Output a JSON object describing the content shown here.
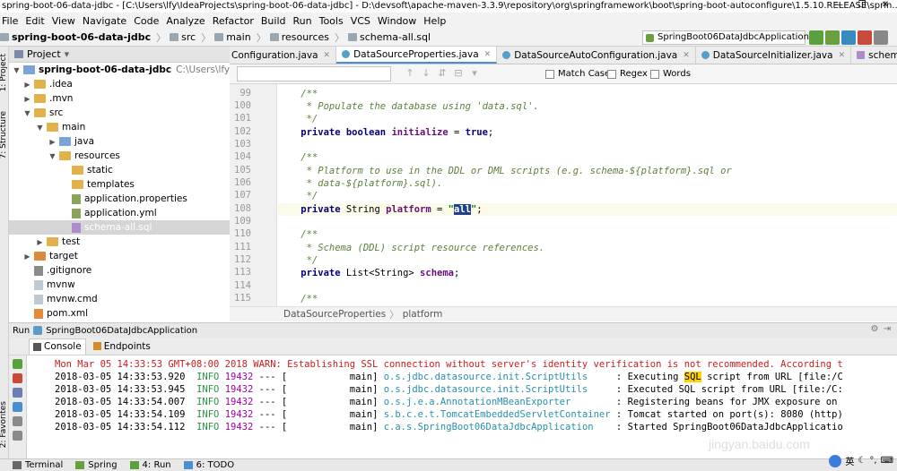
{
  "window": {
    "title": "spring-boot-06-data-jdbc - [C:\\Users\\lfy\\IdeaProjects\\spring-boot-06-data-jdbc] - D:\\devsoft\\apache-maven-3.3.9\\repository\\org\\springframework\\boot\\spring-boot-autoconfigure\\1.5.10.RELEASE\\sprin...",
    "controls": [
      "—",
      "❐",
      "✕"
    ]
  },
  "menu": [
    "File",
    "Edit",
    "View",
    "Navigate",
    "Code",
    "Analyze",
    "Refactor",
    "Build",
    "Run",
    "Tools",
    "VCS",
    "Window",
    "Help"
  ],
  "breadcrumb": [
    "spring-boot-06-data-jdbc",
    "src",
    "main",
    "resources",
    "schema-all.sql"
  ],
  "run_config": "SpringBoot06DataJdbcApplication",
  "sidebar_tabs": {
    "project": "1: Project",
    "structure": "7: Structure",
    "favorites": "2: Favorites"
  },
  "project_panel": {
    "title": "Project",
    "root": {
      "name": "spring-boot-06-data-jdbc",
      "path": "C:\\Users\\lfy\\IdeaProject"
    },
    "items": [
      {
        "label": ".idea"
      },
      {
        "label": ".mvn"
      },
      {
        "label": "src"
      },
      {
        "label": "main"
      },
      {
        "label": "java"
      },
      {
        "label": "resources"
      },
      {
        "label": "static"
      },
      {
        "label": "templates"
      },
      {
        "label": "application.properties"
      },
      {
        "label": "application.yml"
      },
      {
        "label": "schema-all.sql"
      },
      {
        "label": "test"
      },
      {
        "label": "target"
      },
      {
        "label": ".gitignore"
      },
      {
        "label": "mvnw"
      },
      {
        "label": "mvnw.cmd"
      },
      {
        "label": "pom.xml"
      }
    ]
  },
  "editor_tabs": [
    "Configuration.java",
    "DataSourceProperties.java",
    "DataSourceAutoConfiguration.java",
    "DataSourceInitializer.java",
    "schema-all.sql"
  ],
  "search": {
    "match_case": "Match Case",
    "regex": "Regex",
    "words": "Words"
  },
  "editor": {
    "line_numbers": [
      "99",
      "100",
      "101",
      "102",
      "103",
      "104",
      "105",
      "106",
      "107",
      "108",
      "109",
      "110",
      "111",
      "112",
      "113",
      "114",
      "115"
    ],
    "lines": [
      "    /**",
      "     * Populate the database using 'data.sql'.",
      "     */",
      "    private boolean initialize = true;",
      "",
      "    /**",
      "     * Platform to use in the DDL or DML scripts (e.g. schema-${platform}.sql or",
      "     * data-${platform}.sql).",
      "     */",
      "    private String platform = \"all\";",
      "",
      "    /**",
      "     * Schema (DDL) script resource references.",
      "     */",
      "    private List<String> schema;",
      "",
      "    /**"
    ],
    "highlight_word": "all",
    "crumb": [
      "DataSourceProperties",
      "platform"
    ]
  },
  "run_panel": {
    "label": "Run",
    "config": "SpringBoot06DataJdbcApplication",
    "tabs": [
      "Console",
      "Endpoints"
    ]
  },
  "console": [
    {
      "text": "Mon Mar 05 14:33:53 GMT+08:00 2018 WARN: Establishing SSL connection without server's identity verification is not recommended. According t"
    },
    {
      "ts": "2018-03-05 14:33:53.920",
      "level": "INFO",
      "pid": "19432",
      "thread": "main",
      "cls": "o.s.jdbc.datasource.init.ScriptUtils",
      "msg": "Executing SQL script from URL [file:/C"
    },
    {
      "ts": "2018-03-05 14:33:53.945",
      "level": "INFO",
      "pid": "19432",
      "thread": "main",
      "cls": "o.s.jdbc.datasource.init.ScriptUtils",
      "msg": "Executed SQL script from URL [file:/C:"
    },
    {
      "ts": "2018-03-05 14:33:54.007",
      "level": "INFO",
      "pid": "19432",
      "thread": "main",
      "cls": "o.s.j.e.a.AnnotationMBeanExporter",
      "msg": "Registering beans for JMX exposure on"
    },
    {
      "ts": "2018-03-05 14:33:54.109",
      "level": "INFO",
      "pid": "19432",
      "thread": "main",
      "cls": "s.b.c.e.t.TomcatEmbeddedServletContainer",
      "msg": "Tomcat started on port(s): 8080 (http)"
    },
    {
      "ts": "2018-03-05 14:33:54.112",
      "level": "INFO",
      "pid": "19432",
      "thread": "main",
      "cls": "c.a.s.SpringBoot06DataJdbcApplication",
      "msg": "Started SpringBoot06DataJdbcApplicatio"
    }
  ],
  "console_marker": "SQL",
  "statusbar": [
    "Terminal",
    "Spring",
    "4: Run",
    "6: TODO"
  ],
  "tray": {
    "ime": "英"
  },
  "watermark": "jingyan.baidu.com",
  "colors": {
    "selection": "#214283",
    "warn": "#c81e1e",
    "info": "#2b9348",
    "highlight": "#ffd200"
  }
}
